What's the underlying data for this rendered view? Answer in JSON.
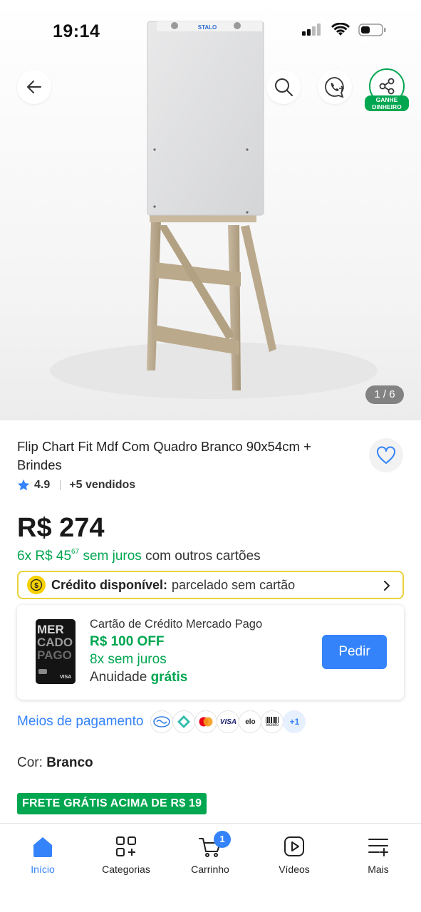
{
  "status_bar": {
    "time": "19:14"
  },
  "hero": {
    "board_brand": "STALO",
    "image_counter": "1 / 6",
    "share_badge_line1": "GANHE",
    "share_badge_line2": "DINHEIRO"
  },
  "product": {
    "title": "Flip Chart Fit Mdf Com Quadro Branco 90x54cm + Brindes",
    "rating": "4.9",
    "sold": "+5 vendidos",
    "price": "R$ 274",
    "installments_prefix": "6x R$ 45",
    "installments_cents": "67",
    "installments_green": "sem juros",
    "installments_suffix": "com outros cartões"
  },
  "credit": {
    "bold": "Crédito disponível:",
    "rest": "parcelado sem cartão"
  },
  "card_offer": {
    "title": "Cartão de Crédito Mercado Pago",
    "off": "R$ 100 OFF",
    "juros": "8x sem juros",
    "anuidade_label": "Anuidade",
    "anuidade_value": "grátis",
    "button": "Pedir",
    "card_text": "MERCADO PAGO",
    "card_brand": "VISA"
  },
  "payment": {
    "label": "Meios de pagamento",
    "methods": [
      "mercado-pago",
      "pix",
      "mastercard",
      "visa",
      "elo",
      "boleto"
    ],
    "visa_text": "VISA",
    "elo_text": "elo",
    "boleto_text": "Boleto",
    "more": "+1"
  },
  "color": {
    "label": "Cor:",
    "value": "Branco"
  },
  "shipping_badge": "FRETE GRÁTIS ACIMA DE R$ 19",
  "nav": {
    "items": [
      {
        "label": "Início",
        "icon": "home-icon"
      },
      {
        "label": "Categorias",
        "icon": "categories-icon"
      },
      {
        "label": "Carrinho",
        "icon": "cart-icon"
      },
      {
        "label": "Vídeos",
        "icon": "video-icon"
      },
      {
        "label": "Mais",
        "icon": "menu-more-icon"
      }
    ],
    "cart_count": "1"
  },
  "colors": {
    "accent": "#3483fa",
    "green": "#00a650",
    "credit_border": "#e8d23a"
  }
}
